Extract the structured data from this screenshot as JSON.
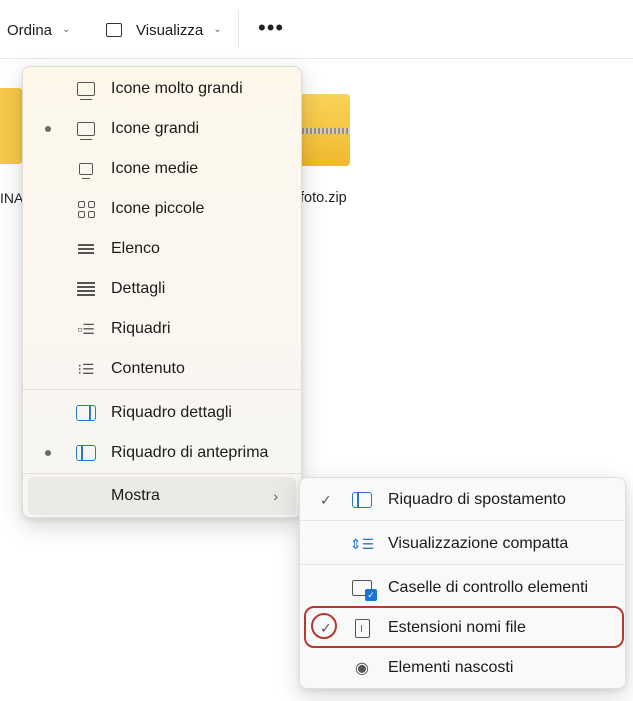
{
  "toolbar": {
    "sort_label": "Ordina",
    "view_label": "Visualizza",
    "more_label": "•••"
  },
  "files": {
    "left_label": "INA",
    "zip_label": "foto.zip"
  },
  "view_menu": {
    "items": [
      {
        "label": "Icone molto grandi",
        "icon": "monitor-icon",
        "selected": false
      },
      {
        "label": "Icone grandi",
        "icon": "monitor-icon",
        "selected": true
      },
      {
        "label": "Icone medie",
        "icon": "monitor-small-icon",
        "selected": false
      },
      {
        "label": "Icone piccole",
        "icon": "grid-icon",
        "selected": false
      },
      {
        "label": "Elenco",
        "icon": "list-icon",
        "selected": false
      },
      {
        "label": "Dettagli",
        "icon": "details-icon",
        "selected": false
      },
      {
        "label": "Riquadri",
        "icon": "tiles-icon",
        "selected": false
      },
      {
        "label": "Contenuto",
        "icon": "content-icon",
        "selected": false
      },
      {
        "label": "Riquadro dettagli",
        "icon": "details-pane-icon",
        "selected": false
      },
      {
        "label": "Riquadro di anteprima",
        "icon": "preview-pane-icon",
        "selected": true
      },
      {
        "label": "Mostra",
        "icon": "",
        "selected": false
      }
    ],
    "submenu_arrow": "›"
  },
  "show_submenu": {
    "items": [
      {
        "label": "Riquadro di spostamento",
        "icon": "navigation-pane-icon",
        "checked": true
      },
      {
        "label": "Visualizzazione compatta",
        "icon": "compact-view-icon",
        "checked": false
      },
      {
        "label": "Caselle di controllo elementi",
        "icon": "item-checkbox-icon",
        "checked": false
      },
      {
        "label": "Estensioni nomi file",
        "icon": "file-extension-icon",
        "checked": true
      },
      {
        "label": "Elementi nascosti",
        "icon": "eye-icon",
        "checked": false
      }
    ],
    "check_glyph": "✓"
  },
  "colors": {
    "accent": "#2a77c9",
    "highlight": "#b5392f",
    "folder": "#f7c948"
  }
}
